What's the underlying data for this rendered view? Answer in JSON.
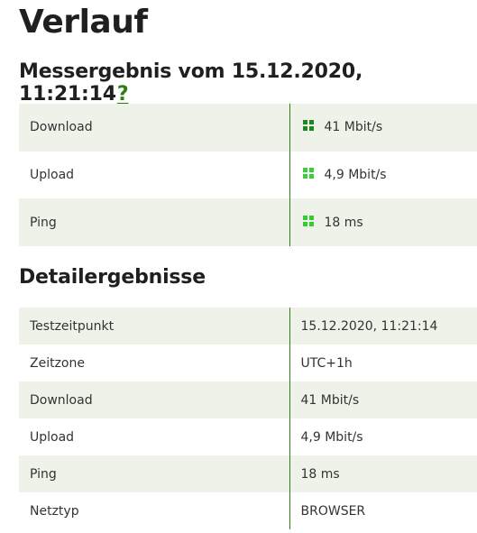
{
  "page": {
    "title": "Verlauf"
  },
  "result": {
    "heading": "Messergebnis vom 15.12.2020, 11:21:14",
    "help_label": "?",
    "rows": [
      {
        "label": "Download",
        "value": "41 Mbit/s",
        "icon": "quality-grid-icon",
        "icon_colors": [
          "#1a8a1a",
          "#1a8a1a",
          "#1a8a1a",
          "#1a8a1a"
        ]
      },
      {
        "label": "Upload",
        "value": "4,9 Mbit/s",
        "icon": "quality-grid-icon",
        "icon_colors": [
          "#36d136",
          "#36d136",
          "#36d136",
          "#36d136"
        ]
      },
      {
        "label": "Ping",
        "value": "18 ms",
        "icon": "quality-grid-icon",
        "icon_colors": [
          "#2fcd2f",
          "#2fcd2f",
          "#2fcd2f",
          "#2fcd2f"
        ]
      }
    ]
  },
  "details": {
    "heading": "Detailergebnisse",
    "rows": [
      {
        "label": "Testzeitpunkt",
        "value": "15.12.2020, 11:21:14"
      },
      {
        "label": "Zeitzone",
        "value": "UTC+1h"
      },
      {
        "label": "Download",
        "value": "41 Mbit/s"
      },
      {
        "label": "Upload",
        "value": "4,9 Mbit/s"
      },
      {
        "label": "Ping",
        "value": "18 ms"
      },
      {
        "label": "Netztyp",
        "value": "BROWSER"
      }
    ]
  },
  "colors": {
    "accent": "#2f7d16",
    "row_stripe": "#eef2e9"
  }
}
